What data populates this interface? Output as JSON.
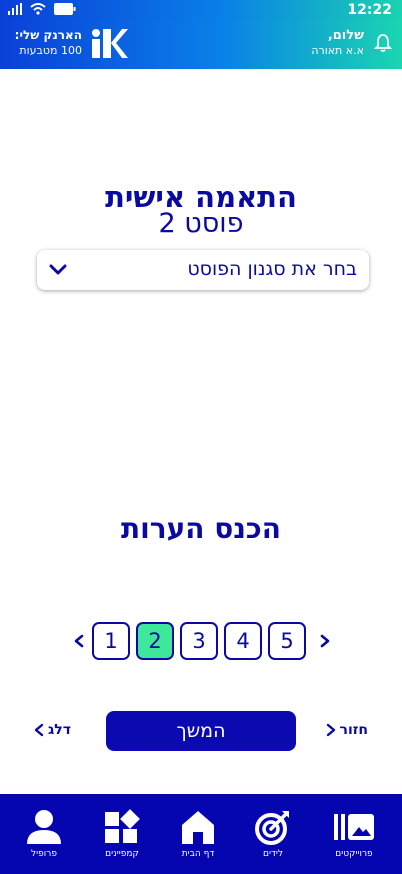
{
  "status": {
    "time": "12:22"
  },
  "header": {
    "balance_title": "הארנק שלי:",
    "balance_value": "100 מטבעות",
    "greeting": "שלום,",
    "username": "א.א תאורה"
  },
  "main": {
    "title": "התאמה אישית",
    "subtitle": "פוסט 2",
    "select_placeholder": "בחר את סגנון הפוסט",
    "comments_title": "הכנס הערות"
  },
  "pager": {
    "pages": [
      "1",
      "2",
      "3",
      "4",
      "5"
    ],
    "active_page": "2"
  },
  "actions": {
    "back_label": "חזור",
    "continue_label": "המשך",
    "skip_label": "דלג"
  },
  "nav": {
    "profile": "פרופיל",
    "campaigns": "קמפיינים",
    "home": "דף הבית",
    "leads": "לידים",
    "projects": "פרוייקטים"
  },
  "colors": {
    "primary": "#0a0ab0",
    "accent": "#3ee89a",
    "header_start": "#0a40d8",
    "header_end": "#1ad6b0"
  }
}
